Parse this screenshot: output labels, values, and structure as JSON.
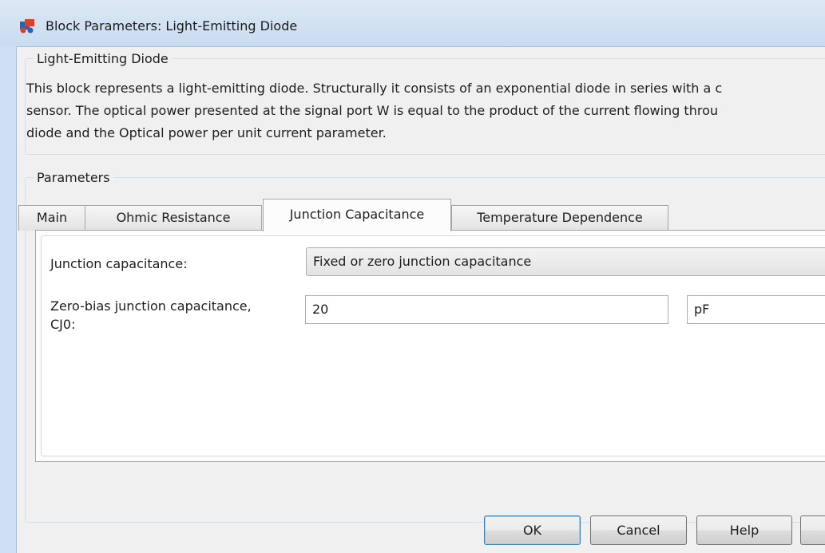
{
  "window": {
    "title": "Block Parameters: Light-Emitting Diode"
  },
  "description": {
    "heading": "Light-Emitting Diode",
    "text": "This block represents a light-emitting diode. Structurally it consists of an exponential diode in series with a c\nsensor. The optical power presented at the signal port W is equal to the product of the current flowing throu\ndiode and the Optical power per unit current parameter."
  },
  "parameters": {
    "heading": "Parameters",
    "tabs": [
      {
        "label": "Main",
        "active": false
      },
      {
        "label": "Ohmic Resistance",
        "active": false
      },
      {
        "label": "Junction Capacitance",
        "active": true
      },
      {
        "label": "Temperature Dependence",
        "active": false
      }
    ],
    "junction_capacitance": {
      "label": "Junction capacitance:",
      "selected": "Fixed or zero junction capacitance"
    },
    "cj0": {
      "label": "Zero-bias junction capacitance,\nCJ0:",
      "value": "20",
      "unit": "pF"
    }
  },
  "buttons": {
    "ok": "OK",
    "cancel": "Cancel",
    "help": "Help",
    "apply": ""
  },
  "icons": {
    "app": "simulink-block-icon"
  }
}
